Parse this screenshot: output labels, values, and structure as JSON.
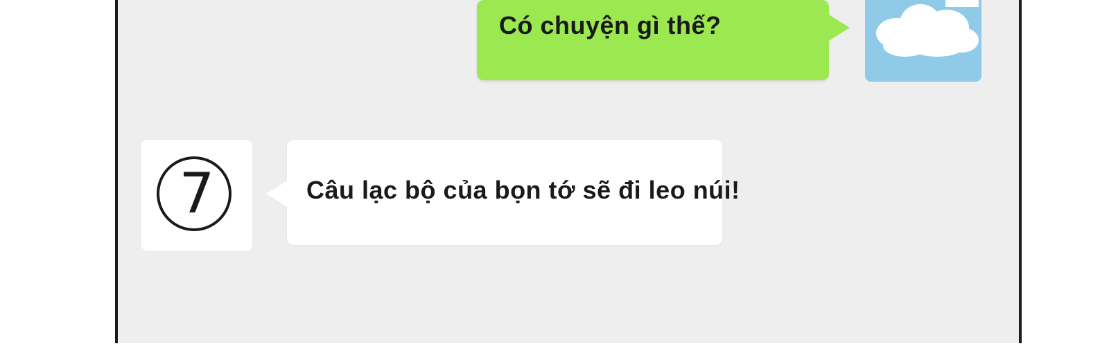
{
  "colors": {
    "screen_background": "#eeeeee",
    "frame_border": "#1a1a18",
    "outgoing_bubble": "#9be851",
    "incoming_bubble": "#ffffff",
    "cloud_avatar_background": "#8fcbe9"
  },
  "messages": [
    {
      "direction": "outgoing",
      "text": "Có chuyện gì thế?",
      "avatar_icon": "cloud-icon"
    },
    {
      "direction": "incoming",
      "text": "Câu lạc bộ của bọn tớ sẽ đi leo núi!",
      "avatar_icon": "circled-seven-icon",
      "avatar_glyph": "7"
    }
  ]
}
